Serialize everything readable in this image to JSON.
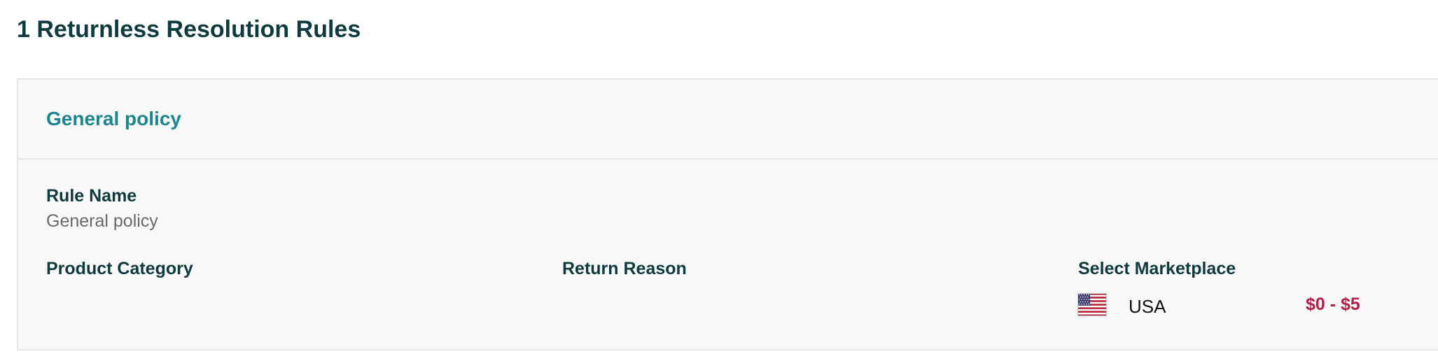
{
  "page": {
    "title": "1 Returnless Resolution Rules"
  },
  "rule": {
    "header_title": "General policy",
    "rule_name_label": "Rule Name",
    "rule_name_value": "General policy",
    "product_category_label": "Product Category",
    "return_reason_label": "Return Reason",
    "select_marketplace_label": "Select Marketplace",
    "marketplaces": [
      {
        "flag_icon": "us-flag-icon",
        "country": "USA",
        "price_range": "$0 - $5"
      }
    ]
  },
  "colors": {
    "heading": "#0f3a40",
    "link_teal": "#1b868d",
    "price_red": "#b12046",
    "card_bg": "#f8f8f8",
    "border": "#e3e6e6"
  }
}
